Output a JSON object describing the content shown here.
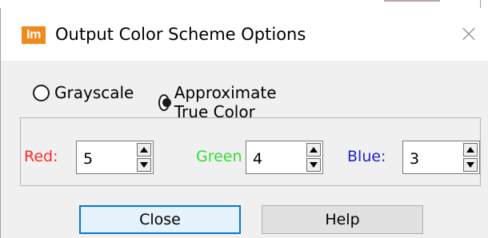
{
  "window": {
    "app_icon_text": "Im",
    "title": "Output Color Scheme Options",
    "close_glyph": "×"
  },
  "color_mode": {
    "options": [
      {
        "label": "Grayscale",
        "selected": false
      },
      {
        "label": "Approximate True Color",
        "selected": true
      }
    ]
  },
  "channels": {
    "red": {
      "label": "Red:",
      "value": "5",
      "color": "#ff2a2a"
    },
    "green": {
      "label": "Green",
      "value": "4",
      "color": "#33dd33"
    },
    "blue": {
      "label": "Blue:",
      "value": "3",
      "color": "#1f1fd0"
    }
  },
  "buttons": {
    "close_label": "Close",
    "help_label": "Help"
  },
  "colors": {
    "app_icon": "#f08a1d",
    "default_button_border": "#0078d7"
  }
}
